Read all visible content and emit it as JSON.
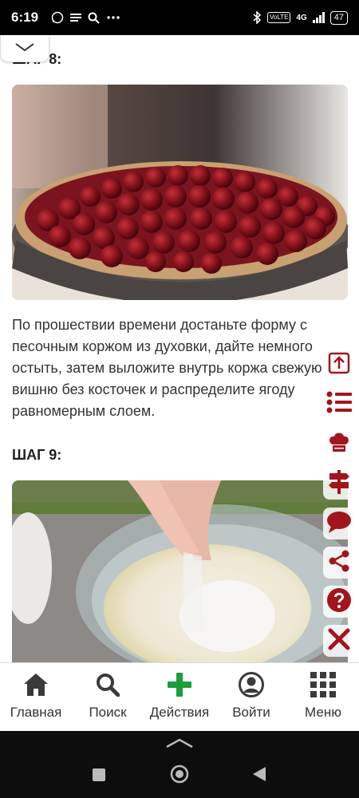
{
  "status_bar": {
    "time": "6:19",
    "network": "4G",
    "volte": "VoLTE",
    "battery": "47"
  },
  "steps": [
    {
      "title": "ШАГ 8:",
      "image_icon": "cherry-tart-photo",
      "text": "По прошествии времени достаньте форму с песочным коржом из духовки, дайте немного остыть, затем выложите внутрь коржа свежую вишню без косточек и распределите ягоду равномерным слоем."
    },
    {
      "title": "ШАГ 9:",
      "image_icon": "mixing-bowl-photo"
    }
  ],
  "side_toolbar": [
    {
      "icon": "arrow-up-icon"
    },
    {
      "icon": "list-icon"
    },
    {
      "icon": "chef-hat-icon"
    },
    {
      "icon": "signpost-icon"
    },
    {
      "icon": "chat-bubble-icon"
    },
    {
      "icon": "share-icon"
    },
    {
      "icon": "help-icon"
    },
    {
      "icon": "close-icon"
    }
  ],
  "bottom_nav": [
    {
      "label": "Главная",
      "icon": "home-icon"
    },
    {
      "label": "Поиск",
      "icon": "search-icon"
    },
    {
      "label": "Действия",
      "icon": "plus-icon"
    },
    {
      "label": "Войти",
      "icon": "user-icon"
    },
    {
      "label": "Меню",
      "icon": "grid-menu-icon"
    }
  ],
  "colors": {
    "accent": "#a3151c",
    "action_green": "#1e9e3a",
    "nav_icon": "#3a3a3a"
  }
}
